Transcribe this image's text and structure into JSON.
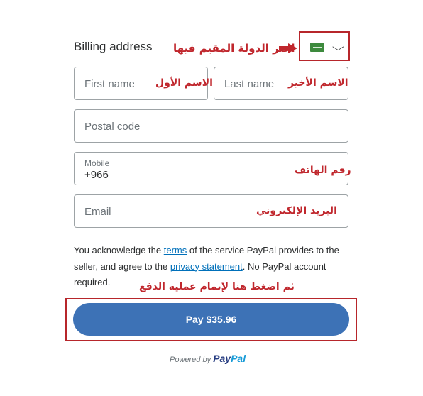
{
  "header": {
    "title": "Billing address",
    "country_annotation": "اختر الدولة المقيم فيها"
  },
  "country_selector": {
    "flag_icon": "saudi-flag-icon",
    "chevron_icon": "chevron-down-icon"
  },
  "fields": {
    "first_name": {
      "placeholder": "First name",
      "annotation": "الاسم الأول"
    },
    "last_name": {
      "placeholder": "Last name",
      "annotation": "الاسم الأخير"
    },
    "postal_code": {
      "placeholder": "Postal code"
    },
    "mobile": {
      "label": "Mobile",
      "value": "+966",
      "annotation": "رقم الهاتف"
    },
    "email": {
      "placeholder": "Email",
      "annotation": "البريد الإلكتروني"
    }
  },
  "legal": {
    "part1": "You acknowledge the ",
    "terms_link": "terms",
    "part2": " of the service PayPal provides to the seller, and agree to the ",
    "privacy_link": "privacy statement",
    "part3": ". No PayPal account required."
  },
  "pay": {
    "annotation": "ثم اضغط هنا لإتمام عملية الدفع",
    "button_label": "Pay $35.96"
  },
  "footer": {
    "powered_by": "Powered by",
    "brand_part1": "Pay",
    "brand_part2": "Pal"
  },
  "colors": {
    "annotation_red": "#c0272d",
    "pay_button": "#3d72b6",
    "link": "#0070ba"
  }
}
